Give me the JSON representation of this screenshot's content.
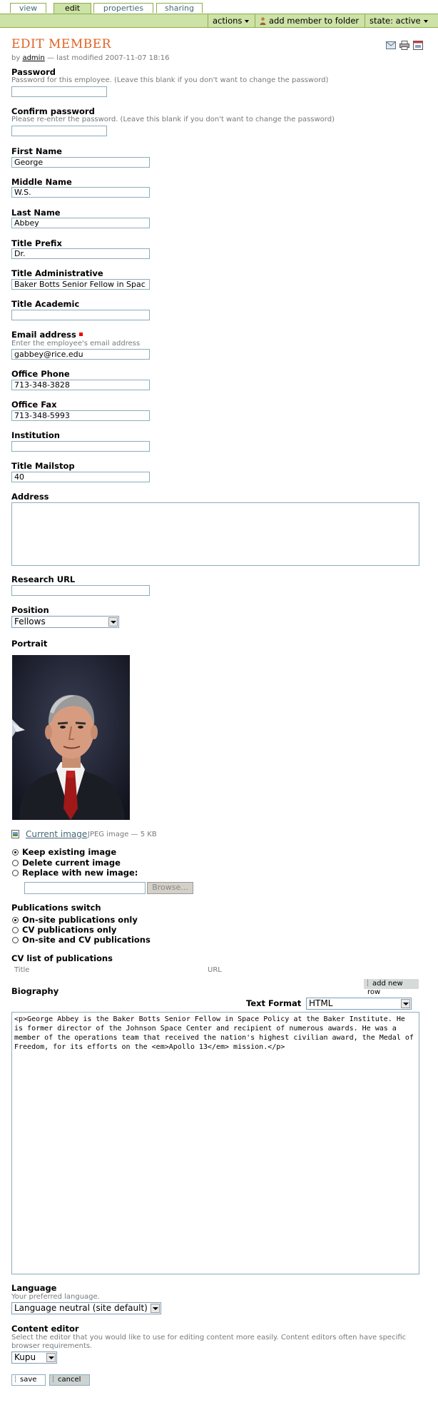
{
  "tabs": [
    {
      "label": "view"
    },
    {
      "label": "edit"
    },
    {
      "label": "properties"
    },
    {
      "label": "sharing"
    }
  ],
  "actionbar": {
    "actions": "actions",
    "add_member": "add member to folder",
    "state": "state: active"
  },
  "header": {
    "title": "EDIT MEMBER",
    "by_prefix": "by",
    "author": "admin",
    "modified": "— last modified 2007-11-07 18:16"
  },
  "fields": {
    "password": {
      "label": "Password",
      "help": "Password for this employee. (Leave this blank if you don't want to change the password)",
      "value": ""
    },
    "confirm": {
      "label": "Confirm password",
      "help": "Please re-enter the password. (Leave this blank if you don't want to change the password)",
      "value": ""
    },
    "first_name": {
      "label": "First Name",
      "value": "George"
    },
    "middle_name": {
      "label": "Middle Name",
      "value": "W.S."
    },
    "last_name": {
      "label": "Last Name",
      "value": "Abbey"
    },
    "title_prefix": {
      "label": "Title Prefix",
      "value": "Dr."
    },
    "title_admin": {
      "label": "Title Administrative",
      "value": "Baker Botts Senior Fellow in Spac"
    },
    "title_academic": {
      "label": "Title Academic",
      "value": ""
    },
    "email": {
      "label": "Email address",
      "help": "Enter the employee's email address",
      "value": "gabbey@rice.edu"
    },
    "office_phone": {
      "label": "Office Phone",
      "value": "713-348-3828"
    },
    "office_fax": {
      "label": "Office Fax",
      "value": "713-348-5993"
    },
    "institution": {
      "label": "Institution",
      "value": ""
    },
    "title_mailstop": {
      "label": "Title Mailstop",
      "value": "40"
    },
    "address": {
      "label": "Address",
      "value": ""
    },
    "research_url": {
      "label": "Research URL",
      "value": ""
    },
    "position": {
      "label": "Position",
      "value": "Fellows"
    },
    "portrait": {
      "label": "Portrait",
      "link": "Current image",
      "meta": "JPEG image — 5 KB"
    }
  },
  "image_options": [
    {
      "label": "Keep existing image",
      "selected": true
    },
    {
      "label": "Delete current image",
      "selected": false
    },
    {
      "label": "Replace with new image:",
      "selected": false
    }
  ],
  "browse_label": "Browse...",
  "publications": {
    "label": "Publications switch",
    "options": [
      {
        "label": "On-site publications only",
        "selected": true
      },
      {
        "label": "CV publications only",
        "selected": false
      },
      {
        "label": "On-site and CV publications",
        "selected": false
      }
    ]
  },
  "cv_list": {
    "label": "CV list of publications",
    "col_title": "Title",
    "col_url": "URL",
    "add_row": "add new row"
  },
  "biography": {
    "label": "Biography",
    "format_label": "Text Format",
    "format_value": "HTML",
    "text": "<p>George Abbey is the Baker Botts Senior Fellow in Space Policy at the Baker Institute. He is former director of the Johnson Space Center and recipient of numerous awards. He was a member of the operations team that received the nation's highest civilian award, the Medal of Freedom, for its efforts on the <em>Apollo 13</em> mission.</p>"
  },
  "language": {
    "label": "Language",
    "help": "Your preferred language.",
    "value": "Language neutral (site default)"
  },
  "content_editor": {
    "label": "Content editor",
    "help": "Select the editor that you would like to use for editing content more easily. Content editors often have specific browser requirements.",
    "value": "Kupu"
  },
  "buttons": {
    "save": "save",
    "cancel": "cancel"
  },
  "colors": {
    "accent_green": "#cde2a7",
    "border_green": "#8cac48",
    "title_orange": "#e06020",
    "input_border": "#8cacbb"
  }
}
